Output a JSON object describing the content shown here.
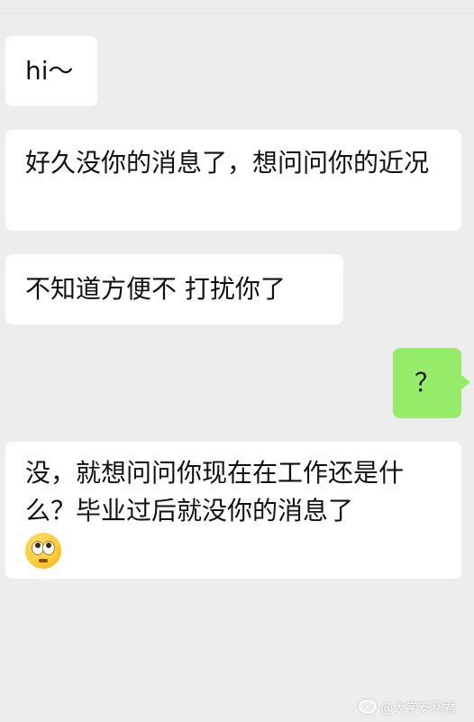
{
  "messages": [
    {
      "side": "left",
      "text": "hi～"
    },
    {
      "side": "left",
      "text": "好久没你的消息了，想问问你的近况"
    },
    {
      "side": "left",
      "text": "不知道方便不 打扰你了"
    },
    {
      "side": "right",
      "text": "？"
    },
    {
      "side": "left",
      "text": "没，就想问问你现在在工作还是什么？毕业过后就没你的消息了",
      "emoji": "flushed-face-emoji"
    }
  ],
  "watermark": {
    "icon": "weibo-logo-icon",
    "text": "@大学安利君"
  }
}
